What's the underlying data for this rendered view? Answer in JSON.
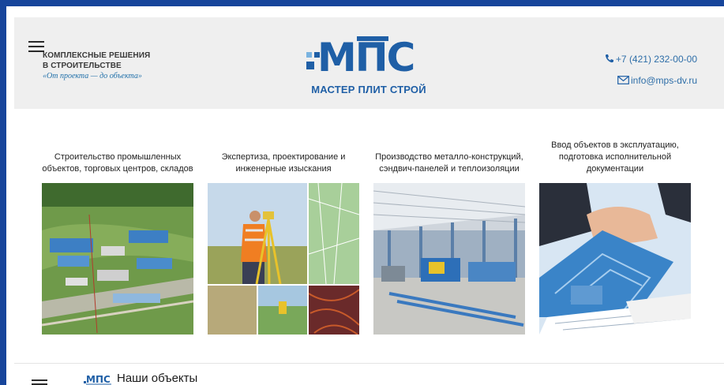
{
  "header": {
    "tagline_line1": "КОМПЛЕКСНЫЕ РЕШЕНИЯ",
    "tagline_line2": "В СТРОИТЕЛЬСТВЕ",
    "tagline_slogan": "«От проекта — до объекта»",
    "logo_text": "МПС",
    "logo_subtitle": "МАСТЕР ПЛИТ СТРОЙ",
    "phone": "+7 (421) 232-00-00",
    "email": "info@mps-dv.ru"
  },
  "services": [
    {
      "title": "Строительство промышленных объектов, торговых центров, складов",
      "icon": "industrial-site-photo"
    },
    {
      "title": "Экспертиза, проектирование и инженерные изыскания",
      "icon": "surveyor-photo"
    },
    {
      "title": "Производство металло-конструкций, сэндвич-панелей и теплоизоляции",
      "icon": "factory-photo"
    },
    {
      "title": "Ввод объектов в эксплуатацию, подготовка исполнительной документации",
      "icon": "handshake-photo"
    }
  ],
  "bottom": {
    "mini_logo_text": "МПС",
    "section_title": "Наши объекты"
  },
  "colors": {
    "frame": "#17459b",
    "brand_blue": "#1f5fa6",
    "header_bg": "#efefef",
    "link_blue": "#2e6ea8"
  }
}
